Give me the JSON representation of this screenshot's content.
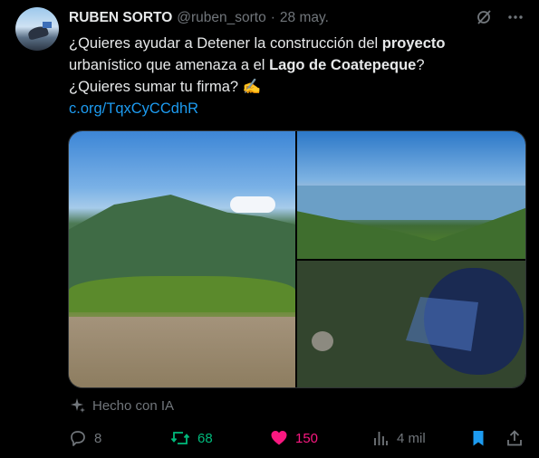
{
  "author": {
    "name": "RUBEN SORTO",
    "handle": "@ruben_sorto",
    "separator": "·",
    "date": "28 may."
  },
  "tweet": {
    "line1_pre": "¿Quieres ayudar a Detener la construcción del ",
    "line1_bold": "proyecto",
    "line2_pre": "urbanístico que amenaza a el ",
    "line2_bold": "Lago de Coatepeque",
    "line2_post": "?",
    "line3": "¿Quieres sumar tu firma? ✍️",
    "link": "c.org/TqxCyCCdhR"
  },
  "ai_label": "Hecho con IA",
  "actions": {
    "replies": "8",
    "reposts": "68",
    "likes": "150",
    "views": "4 mil"
  },
  "colors": {
    "link": "#1d9bf0",
    "repost": "#00ba7c",
    "like": "#f91880",
    "bookmark": "#1d9bf0",
    "muted": "#71767b"
  },
  "icons": [
    "grok-icon",
    "more-icon",
    "sparkle-icon",
    "reply-icon",
    "repost-icon",
    "like-icon",
    "views-icon",
    "bookmark-icon",
    "share-icon"
  ]
}
